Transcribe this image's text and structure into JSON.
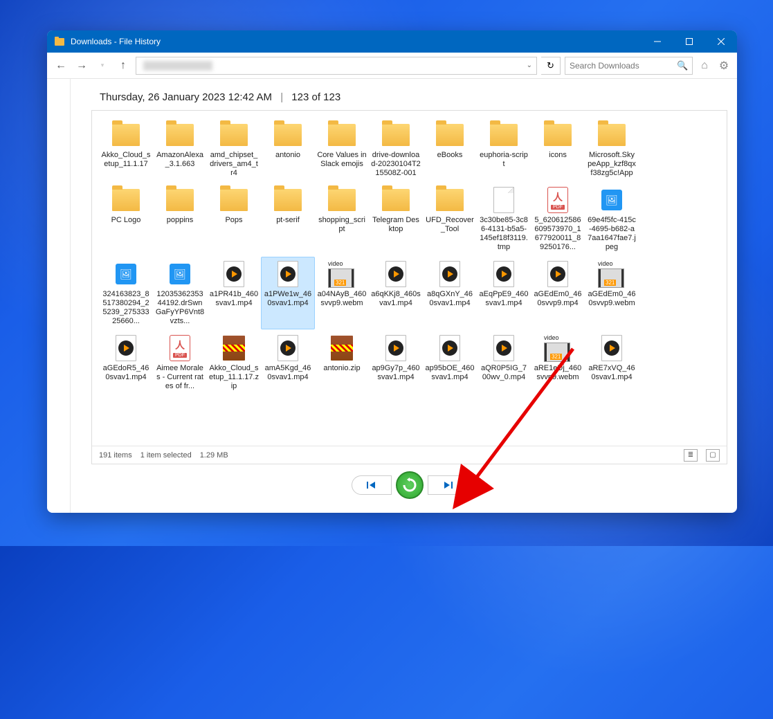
{
  "window": {
    "title": "Downloads - File History"
  },
  "toolbar": {
    "search_placeholder": "Search Downloads"
  },
  "snapshot": {
    "datetime": "Thursday, 26 January 2023 12:42 AM",
    "counter": "123 of 123"
  },
  "status": {
    "item_count": "191 items",
    "selection": "1 item selected",
    "size": "1.29 MB"
  },
  "items": [
    {
      "name": "Akko_Cloud_setup_11.1.17",
      "type": "folder"
    },
    {
      "name": "AmazonAlexa_3.1.663",
      "type": "folder"
    },
    {
      "name": "amd_chipset_drivers_am4_tr4",
      "type": "folder"
    },
    {
      "name": "antonio",
      "type": "folder"
    },
    {
      "name": "Core Values in Slack emojis",
      "type": "folder"
    },
    {
      "name": "drive-download-20230104T215508Z-001",
      "type": "folder"
    },
    {
      "name": "eBooks",
      "type": "folder"
    },
    {
      "name": "euphoria-script",
      "type": "folder"
    },
    {
      "name": "icons",
      "type": "folder"
    },
    {
      "name": "Microsoft.SkypeApp_kzf8qxf38zg5c!App",
      "type": "folder"
    },
    {
      "name": "PC Logo",
      "type": "folder"
    },
    {
      "name": "poppins",
      "type": "folder"
    },
    {
      "name": "Pops",
      "type": "folder"
    },
    {
      "name": "pt-serif",
      "type": "folder"
    },
    {
      "name": "shopping_script",
      "type": "folder"
    },
    {
      "name": "Telegram Desktop",
      "type": "folder"
    },
    {
      "name": "UFD_Recover_Tool",
      "type": "folder"
    },
    {
      "name": "3c30be85-3c86-4131-b5a5-145ef18f3119.tmp",
      "type": "file"
    },
    {
      "name": "5_620612586609573970_1677920011_89250176...",
      "type": "pdf"
    },
    {
      "name": "69e4f5fc-415c-4695-b682-a7aa1647fae7.jpeg",
      "type": "image"
    },
    {
      "name": "324163823_8517380294_25239_27533325660...",
      "type": "image"
    },
    {
      "name": "1203536235344192.drSwnGaFyYP6Vnt8vzts...",
      "type": "image"
    },
    {
      "name": "a1PR41b_460svav1.mp4",
      "type": "mp4"
    },
    {
      "name": "a1PWe1w_460svav1.mp4",
      "type": "mp4",
      "selected": true
    },
    {
      "name": "a04NAyB_460svvp9.webm",
      "type": "webm"
    },
    {
      "name": "a6qKKj8_460svav1.mp4",
      "type": "mp4"
    },
    {
      "name": "a8qGXnY_460svav1.mp4",
      "type": "mp4"
    },
    {
      "name": "aEqPpE9_460svav1.mp4",
      "type": "mp4"
    },
    {
      "name": "aGEdEm0_460svvp9.mp4",
      "type": "mp4"
    },
    {
      "name": "aGEdEm0_460svvp9.webm",
      "type": "webm"
    },
    {
      "name": "aGEdoR5_460svav1.mp4",
      "type": "mp4"
    },
    {
      "name": "Aimee Morales - Current rates of fr...",
      "type": "pdf"
    },
    {
      "name": "Akko_Cloud_setup_11.1.17.zip",
      "type": "zip"
    },
    {
      "name": "amA5Kgd_460svav1.mp4",
      "type": "mp4"
    },
    {
      "name": "antonio.zip",
      "type": "zip"
    },
    {
      "name": "ap9Gy7p_460svav1.mp4",
      "type": "mp4"
    },
    {
      "name": "ap95bOE_460svav1.mp4",
      "type": "mp4"
    },
    {
      "name": "aQR0P5IG_700wv_0.mp4",
      "type": "mp4"
    },
    {
      "name": "aRE1eDj_460svvp9.webm",
      "type": "webm"
    },
    {
      "name": "aRE7xVQ_460svav1.mp4",
      "type": "mp4"
    }
  ]
}
